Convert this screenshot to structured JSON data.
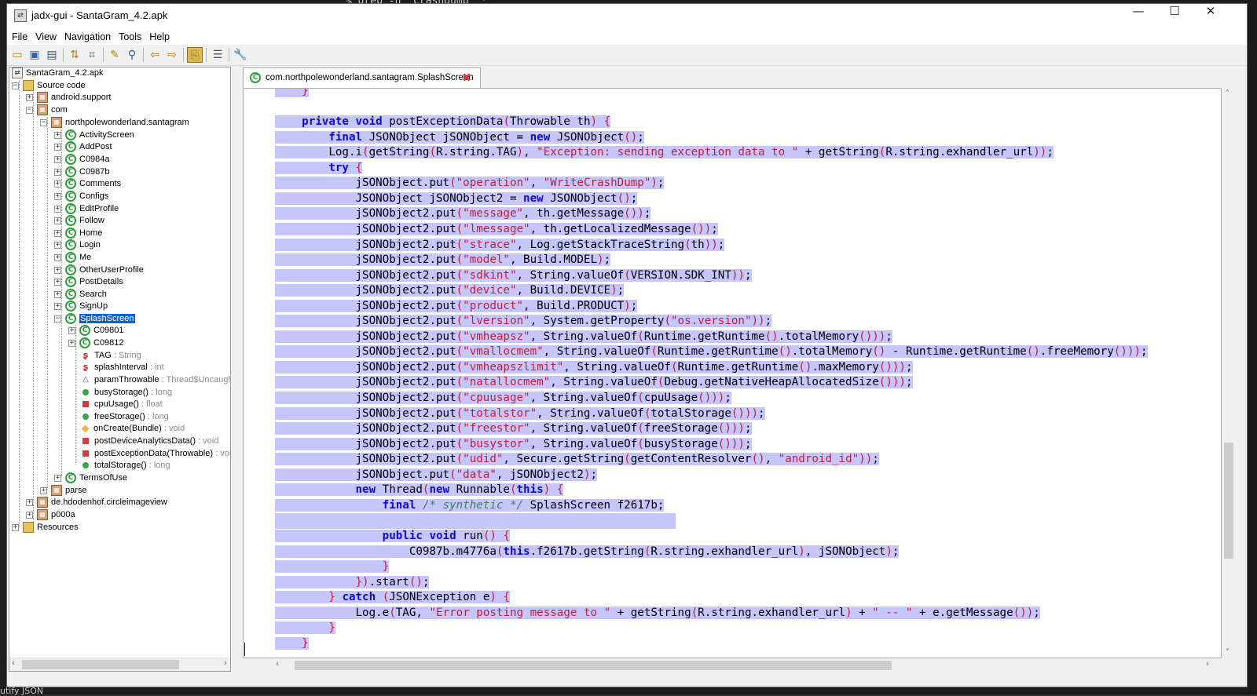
{
  "background": {
    "terminal_fragment": "% grep -n 'CrashDump' *",
    "bottom_text": "utify JSON"
  },
  "window": {
    "title": "jadx-gui - SantaGram_4.2.apk",
    "controls": {
      "minimize": "—",
      "maximize": "☐",
      "close": "✕"
    }
  },
  "menu": [
    "File",
    "View",
    "Navigation",
    "Tools",
    "Help"
  ],
  "toolbar_icons": [
    "open-file-icon",
    "save-icon",
    "save-all-icon",
    "sync-tree-icon",
    "flatten-packages-icon",
    "text-search-icon",
    "class-search-icon",
    "back-icon",
    "forward-icon",
    "deobfuscation-icon",
    "log-viewer-icon",
    "preferences-icon"
  ],
  "tree": {
    "root": "SantaGram_4.2.apk",
    "source_code": "Source code",
    "android_support": "android.support",
    "com": "com",
    "package": "northpolewonderland.santagram",
    "classes": [
      "ActivityScreen",
      "AddPost",
      "C0984a",
      "C0987b",
      "Comments",
      "Configs",
      "EditProfile",
      "Follow",
      "Home",
      "Login",
      "Me",
      "OtherUserProfile",
      "PostDetails",
      "Search",
      "SignUp"
    ],
    "selected_class": "SplashScreen",
    "inner_classes": [
      "C09801",
      "C09812"
    ],
    "fields": [
      {
        "name": "TAG",
        "type": " : String"
      },
      {
        "name": "splashInterval",
        "type": " : int"
      },
      {
        "name": "paramThrowable",
        "type": " : Thread$Uncaught"
      }
    ],
    "methods": [
      {
        "name": "busyStorage()",
        "type": " : long"
      },
      {
        "name": "cpuUsage()",
        "type": " : float"
      },
      {
        "name": "freeStorage()",
        "type": " : long"
      },
      {
        "name": "onCreate(Bundle)",
        "type": " : void"
      },
      {
        "name": "postDeviceAnalyticsData()",
        "type": " : void"
      },
      {
        "name": "postExceptionData(Throwable)",
        "type": " : void"
      },
      {
        "name": "totalStorage()",
        "type": " : long"
      }
    ],
    "terms_of_use": "TermsOfUse",
    "parse": "parse",
    "circleimageview": "de.hdodenhof.circleimageview",
    "p000a": "p000a",
    "resources": "Resources"
  },
  "editor": {
    "tab_title": "com.northpolewonderland.santagram.SplashScreen",
    "code_lines": [
      "    }",
      "",
      "    private void postExceptionData(Throwable th) {",
      "        final JSONObject jSONObject = new JSONObject();",
      "        Log.i(getString(R.string.TAG), \"Exception: sending exception data to \" + getString(R.string.exhandler_url));",
      "        try {",
      "            jSONObject.put(\"operation\", \"WriteCrashDump\");",
      "            JSONObject jSONObject2 = new JSONObject();",
      "            jSONObject2.put(\"message\", th.getMessage());",
      "            jSONObject2.put(\"lmessage\", th.getLocalizedMessage());",
      "            jSONObject2.put(\"strace\", Log.getStackTraceString(th));",
      "            jSONObject2.put(\"model\", Build.MODEL);",
      "            jSONObject2.put(\"sdkint\", String.valueOf(VERSION.SDK_INT));",
      "            jSONObject2.put(\"device\", Build.DEVICE);",
      "            jSONObject2.put(\"product\", Build.PRODUCT);",
      "            jSONObject2.put(\"lversion\", System.getProperty(\"os.version\"));",
      "            jSONObject2.put(\"vmheapsz\", String.valueOf(Runtime.getRuntime().totalMemory()));",
      "            jSONObject2.put(\"vmallocmem\", String.valueOf(Runtime.getRuntime().totalMemory() - Runtime.getRuntime().freeMemory()));",
      "            jSONObject2.put(\"vmheapszlimit\", String.valueOf(Runtime.getRuntime().maxMemory()));",
      "            jSONObject2.put(\"natallocmem\", String.valueOf(Debug.getNativeHeapAllocatedSize()));",
      "            jSONObject2.put(\"cpuusage\", String.valueOf(cpuUsage()));",
      "            jSONObject2.put(\"totalstor\", String.valueOf(totalStorage()));",
      "            jSONObject2.put(\"freestor\", String.valueOf(freeStorage()));",
      "            jSONObject2.put(\"busystor\", String.valueOf(busyStorage()));",
      "            jSONObject2.put(\"udid\", Secure.getString(getContentResolver(), \"android_id\"));",
      "            jSONObject.put(\"data\", jSONObject2);",
      "            new Thread(new Runnable(this) {",
      "                final /* synthetic */ SplashScreen f2617b;",
      "",
      "                public void run() {",
      "                    C0987b.m4776a(this.f2617b.getString(R.string.exhandler_url), jSONObject);",
      "                }",
      "            }).start();",
      "        } catch (JSONException e) {",
      "            Log.e(TAG, \"Error posting message to \" + getString(R.string.exhandler_url) + \" -- \" + e.getMessage());",
      "        }",
      "    }"
    ]
  },
  "colors": {
    "selection": "#c6c6fd",
    "keyword": "#0d0dd0",
    "string": "#c0203a",
    "tree_selected": "#0a64c4"
  }
}
